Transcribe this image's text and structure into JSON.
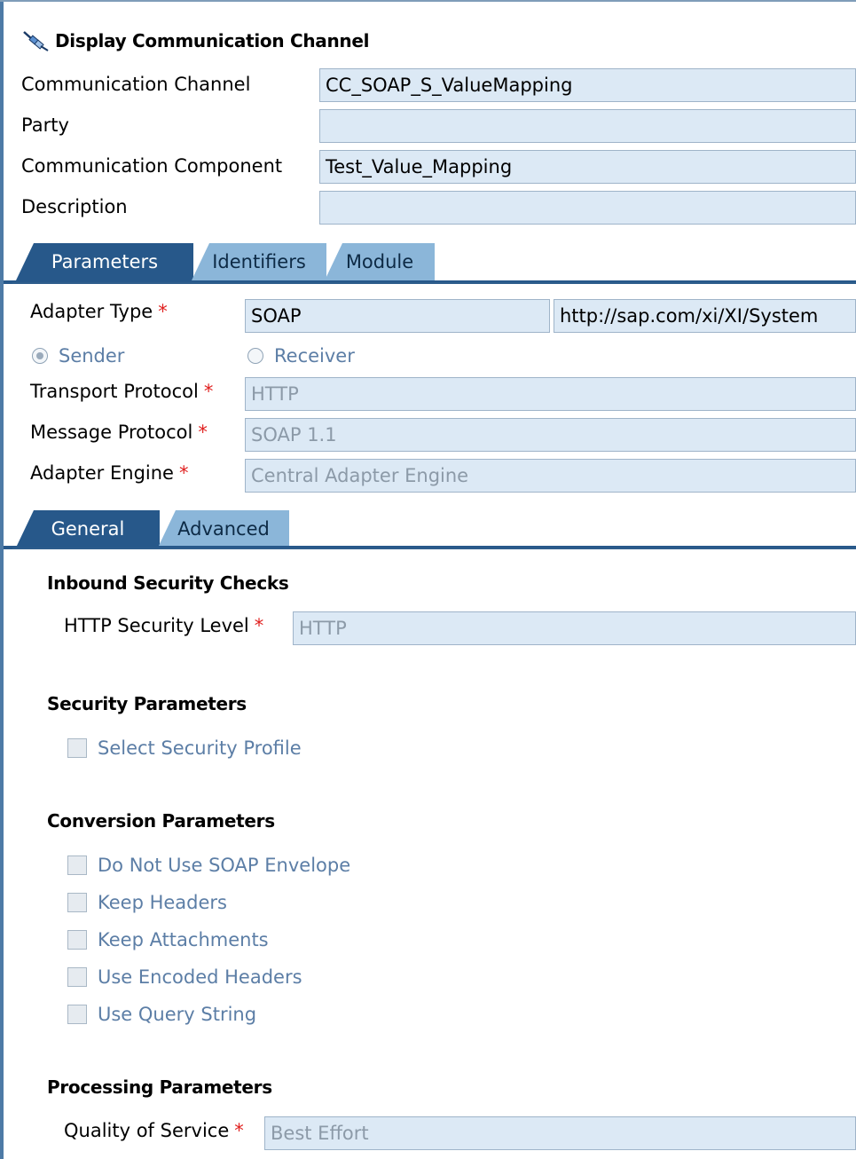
{
  "header": {
    "title": "Display Communication Channel",
    "title_icon": "channel-plug-icon"
  },
  "general": {
    "channel_label": "Communication Channel",
    "channel_value": "CC_SOAP_S_ValueMapping",
    "party_label": "Party",
    "party_value": "",
    "component_label": "Communication Component",
    "component_value": "Test_Value_Mapping",
    "description_label": "Description",
    "description_value": ""
  },
  "tabs": [
    "Parameters",
    "Identifiers",
    "Module"
  ],
  "parameters": {
    "adapter_type_label": "Adapter Type",
    "adapter_type_value": "SOAP",
    "adapter_namespace": "http://sap.com/xi/XI/System",
    "direction_options": [
      "Sender",
      "Receiver"
    ],
    "direction_selected": "Sender",
    "transport_label": "Transport Protocol",
    "transport_value": "HTTP",
    "message_label": "Message Protocol",
    "message_value": "SOAP 1.1",
    "engine_label": "Adapter Engine",
    "engine_value": "Central Adapter Engine",
    "required_marker": "*"
  },
  "subtabs": [
    "General",
    "Advanced"
  ],
  "inbound": {
    "heading": "Inbound Security Checks",
    "level_label": "HTTP Security Level",
    "level_value": "HTTP"
  },
  "security": {
    "heading": "Security Parameters",
    "profile_label": "Select Security Profile"
  },
  "conversion": {
    "heading": "Conversion Parameters",
    "options": [
      "Do Not Use SOAP Envelope",
      "Keep Headers",
      "Keep Attachments",
      "Use Encoded Headers",
      "Use Query String"
    ]
  },
  "processing": {
    "heading": "Processing Parameters",
    "qos_label": "Quality of Service",
    "qos_value": "Best Effort"
  },
  "colors": {
    "tab_active": "#27588a",
    "tab_inactive": "#8bb6d9",
    "field_bg": "#dce9f5",
    "required": "#e0201f",
    "disabled_text": "#5c7ea6"
  }
}
